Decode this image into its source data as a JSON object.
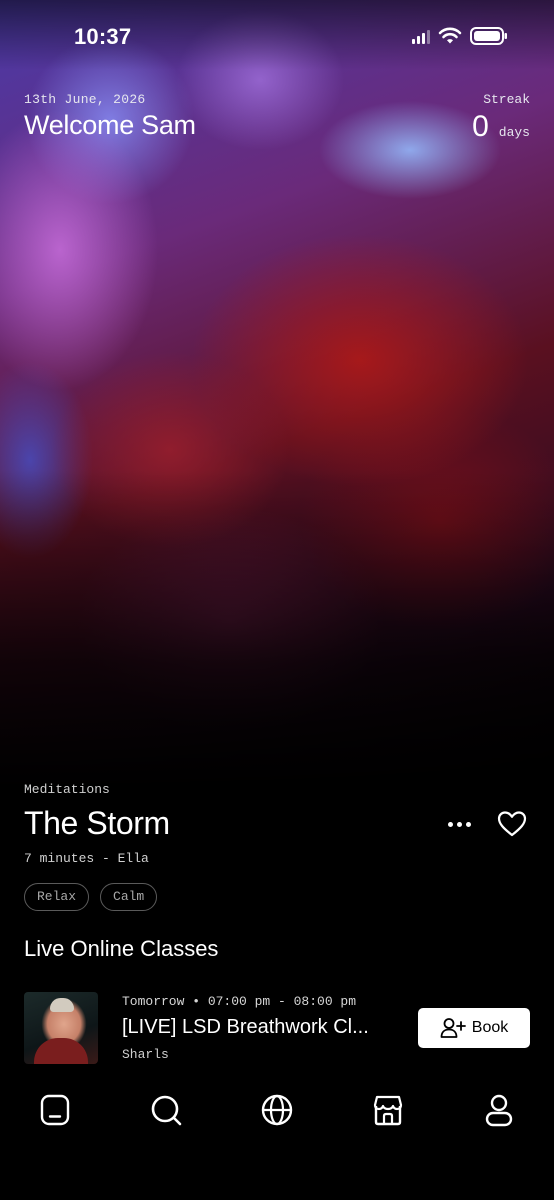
{
  "status_bar": {
    "time": "10:37"
  },
  "header": {
    "date": "13th June, 2026",
    "welcome": "Welcome Sam",
    "streak_label": "Streak",
    "streak_value": "0",
    "streak_unit": "days"
  },
  "meditation": {
    "category": "Meditations",
    "title": "The Storm",
    "meta": "7 minutes - Ella",
    "tags": [
      "Relax",
      "Calm"
    ]
  },
  "live_classes": {
    "section_title": "Live Online Classes",
    "items": [
      {
        "time": "Tomorrow • 07:00 pm - 08:00 pm",
        "title": "[LIVE] LSD Breathwork Cl...",
        "host": "Sharls",
        "book_label": "Book"
      }
    ]
  },
  "tabbar": {
    "icons": [
      "home-icon",
      "search-icon",
      "globe-icon",
      "store-icon",
      "profile-icon"
    ]
  },
  "colors": {
    "background": "#000000",
    "text": "#ffffff",
    "muted": "#a8a8a8"
  }
}
